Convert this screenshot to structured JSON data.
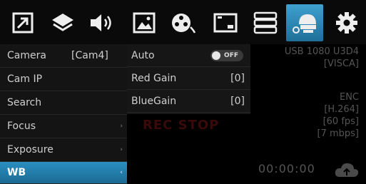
{
  "toolbar": {
    "buttons": [
      {
        "name": "layout-icon",
        "active": false
      },
      {
        "name": "layers-icon",
        "active": false
      },
      {
        "name": "speaker-icon",
        "active": false
      },
      {
        "name": "image-icon",
        "active": false
      },
      {
        "name": "film-reel-icon",
        "active": false
      },
      {
        "name": "display-icon",
        "active": false
      },
      {
        "name": "storage-icon",
        "active": false
      },
      {
        "name": "camera-settings-icon",
        "active": true
      },
      {
        "name": "gear-icon",
        "active": false
      }
    ]
  },
  "menu": {
    "items": [
      {
        "label": "Camera",
        "value": "[Cam4]",
        "arrow": ""
      },
      {
        "label": "Cam IP",
        "value": "",
        "arrow": ""
      },
      {
        "label": "Search",
        "value": "",
        "arrow": ""
      },
      {
        "label": "Focus",
        "value": "",
        "arrow": "›"
      },
      {
        "label": "Exposure",
        "value": "",
        "arrow": "›"
      },
      {
        "label": "WB",
        "value": "",
        "arrow": "‹"
      }
    ]
  },
  "submenu": {
    "items": [
      {
        "label": "Auto",
        "toggle": "OFF"
      },
      {
        "label": "Red Gain",
        "value": "[0]"
      },
      {
        "label": "BlueGain",
        "value": "[0]"
      }
    ]
  },
  "status": {
    "camera": "USB 1080 U3D4",
    "protocol": "[VISCA]",
    "enc_label": "ENC",
    "codec": "[H.264]",
    "fps": "[60 fps]",
    "bitrate": "[7 mbps]"
  },
  "rec_indicator": "REC STOP",
  "timer": "00:00:00",
  "colors": {
    "accent": "#2b8fc0",
    "background": "#000000"
  }
}
